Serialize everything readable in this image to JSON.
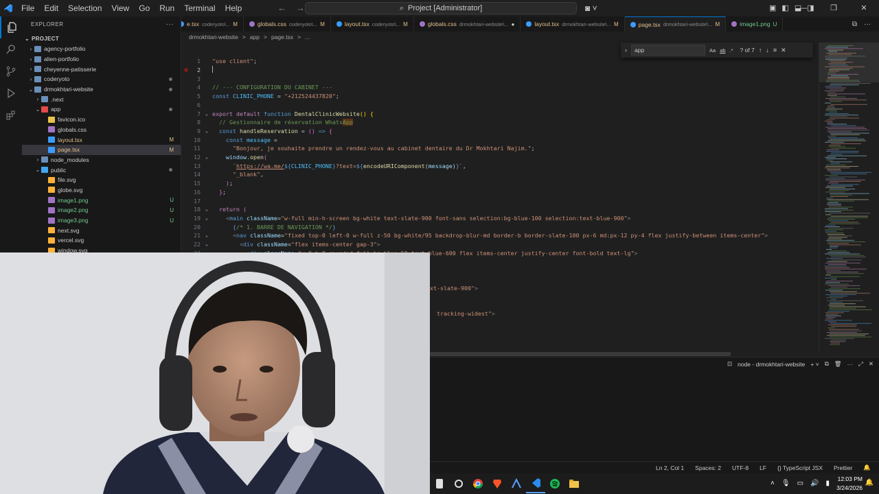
{
  "titlebar": {
    "menu": [
      "File",
      "Edit",
      "Selection",
      "View",
      "Go",
      "Run",
      "Terminal",
      "Help"
    ],
    "search_text": "Project [Administrator]"
  },
  "sidebar": {
    "title": "EXPLORER",
    "project_label": "PROJECT",
    "items": [
      {
        "label": "agency-portfolio",
        "type": "folder",
        "depth": 1,
        "open": false
      },
      {
        "label": "alien-portfolio",
        "type": "folder",
        "depth": 1,
        "open": false
      },
      {
        "label": "cheyenne-patisserie",
        "type": "folder",
        "depth": 1,
        "open": false
      },
      {
        "label": "coderyoto",
        "type": "folder",
        "depth": 1,
        "open": false,
        "dot": true
      },
      {
        "label": "drmokhtari-website",
        "type": "folder",
        "depth": 1,
        "open": true,
        "dot": true
      },
      {
        "label": ".next",
        "type": "folder",
        "depth": 2,
        "open": false
      },
      {
        "label": "app",
        "type": "folder-app",
        "depth": 2,
        "open": true,
        "dot": true
      },
      {
        "label": "favicon.ico",
        "type": "star",
        "depth": 3
      },
      {
        "label": "globals.css",
        "type": "css",
        "depth": 3
      },
      {
        "label": "layout.tsx",
        "type": "tsx",
        "depth": 3,
        "badge": "M"
      },
      {
        "label": "page.tsx",
        "type": "tsx",
        "depth": 3,
        "badge": "M",
        "selected": true
      },
      {
        "label": "node_modules",
        "type": "folder",
        "depth": 2,
        "open": false
      },
      {
        "label": "public",
        "type": "folder-public",
        "depth": 2,
        "open": true,
        "dot": true
      },
      {
        "label": "file.svg",
        "type": "svg",
        "depth": 3
      },
      {
        "label": "globe.svg",
        "type": "svg",
        "depth": 3
      },
      {
        "label": "image1.png",
        "type": "png",
        "depth": 3,
        "badge": "U"
      },
      {
        "label": "image2.png",
        "type": "png",
        "depth": 3,
        "badge": "U"
      },
      {
        "label": "image3.png",
        "type": "png",
        "depth": 3,
        "badge": "U"
      },
      {
        "label": "next.svg",
        "type": "svg",
        "depth": 3
      },
      {
        "label": "vercel.svg",
        "type": "svg",
        "depth": 3
      },
      {
        "label": "window.svg",
        "type": "svg",
        "depth": 3
      }
    ]
  },
  "tabs": [
    {
      "name": "e.tsx",
      "path": "coderyoto\\...",
      "mod": "M",
      "icon": "tsx"
    },
    {
      "name": "globals.css",
      "path": "coderyoto\\...",
      "mod": "M",
      "icon": "css"
    },
    {
      "name": "layout.tsx",
      "path": "coderyoto\\...",
      "mod": "M",
      "icon": "tsx"
    },
    {
      "name": "globals.css",
      "path": "drmokhtari-website\\...",
      "mod": "●",
      "icon": "css"
    },
    {
      "name": "layout.tsx",
      "path": "drmokhtari-website\\...",
      "mod": "M",
      "icon": "tsx"
    },
    {
      "name": "page.tsx",
      "path": "drmokhtari-website\\...",
      "mod": "M",
      "icon": "tsx",
      "active": true
    },
    {
      "name": "image1.png",
      "path": "",
      "mod": "U",
      "icon": "png"
    }
  ],
  "breadcrumb": [
    "drmokhtari-website",
    ">",
    "app",
    ">",
    "page.tsx",
    ">",
    "..."
  ],
  "find": {
    "value": "app",
    "count": "? of 7"
  },
  "editor": {
    "current_line": 2,
    "lines": [
      {
        "n": 1,
        "fold": "",
        "html": "<span class='t-str'>\"use client\"</span>;"
      },
      {
        "n": 2,
        "fold": "",
        "html": ""
      },
      {
        "n": 3,
        "fold": "",
        "html": ""
      },
      {
        "n": 4,
        "fold": "",
        "html": "<span class='t-cmt'>// --- CONFIGURATION DU CABINET ---</span>"
      },
      {
        "n": 5,
        "fold": "",
        "html": "<span class='t-kw'>const</span> <span class='t-const'>CLINIC_PHONE</span> = <span class='t-str'>\"+212524437820\"</span>;"
      },
      {
        "n": 6,
        "fold": "",
        "html": ""
      },
      {
        "n": 7,
        "fold": "v",
        "html": "<span class='t-ctl'>export</span> <span class='t-ctl'>default</span> <span class='t-kw'>function</span> <span class='t-fn'>DentalClinicWebsite</span><span class='t-yel'>()</span> <span class='t-yel'>{</span>"
      },
      {
        "n": 8,
        "fold": "",
        "html": "  <span class='t-cmt'>// Gestionnaire de réservation Whats<span class='t-hl'>App</span></span>"
      },
      {
        "n": 9,
        "fold": "v",
        "html": "  <span class='t-kw'>const</span> <span class='t-fn'>handleReservation</span> = <span class='t-pink'>()</span> <span class='t-kw'>=&gt;</span> <span class='t-pink'>{</span>"
      },
      {
        "n": 10,
        "fold": "",
        "html": "    <span class='t-kw'>const</span> <span class='t-const'>message</span> ="
      },
      {
        "n": 11,
        "fold": "",
        "html": "      <span class='t-str'>\"Bonjour, je souhaite prendre un rendez-vous au cabinet dentaire du Dr Mokhtari Najim.\"</span>;"
      },
      {
        "n": 12,
        "fold": "v",
        "html": "    <span class='t-var'>window</span>.<span class='t-fn'>open</span><span class='t-pink'>(</span>"
      },
      {
        "n": 13,
        "fold": "",
        "html": "      <span class='t-str'>`<u>https://wa.me/</u></span><span class='t-kw'>${</span><span class='t-const'>CLINIC_PHONE</span><span class='t-kw'>}</span><span class='t-str'>?text=</span><span class='t-kw'>${</span><span class='t-fn'>encodeURIComponent</span>(<span class='t-var'>message</span>)<span class='t-kw'>}</span><span class='t-str'>`</span>,"
      },
      {
        "n": 14,
        "fold": "",
        "html": "      <span class='t-str'>\"_blank\"</span>,"
      },
      {
        "n": 15,
        "fold": "",
        "html": "    <span class='t-pink'>)</span>;"
      },
      {
        "n": 16,
        "fold": "",
        "html": "  <span class='t-pink'>}</span>;"
      },
      {
        "n": 17,
        "fold": "",
        "html": ""
      },
      {
        "n": 18,
        "fold": "v",
        "html": "  <span class='t-ctl'>return</span> <span class='t-pink'>(</span>"
      },
      {
        "n": 19,
        "fold": "v",
        "html": "    <span class='t-punct'>&lt;</span><span class='t-tag'>main</span> <span class='t-attr'>className</span>=<span class='t-str'>\"w-full min-h-screen bg-white text-slate-900 font-sans selection:bg-blue-100 selection:text-blue-900\"</span><span class='t-punct'>&gt;</span>"
      },
      {
        "n": 20,
        "fold": "",
        "html": "      <span class='t-kw'>{</span><span class='t-cmt'>/* 1. BARRE DE NAVIGATION */</span><span class='t-kw'>}</span>"
      },
      {
        "n": 21,
        "fold": "v",
        "html": "      <span class='t-punct'>&lt;</span><span class='t-tag'>nav</span> <span class='t-attr'>className</span>=<span class='t-str'>\"fixed top-0 left-0 w-full z-50 bg-white/95 backdrop-blur-md border-b border-slate-100 px-6 md:px-12 py-4 flex justify-between items-center\"</span><span class='t-punct'>&gt;</span>"
      },
      {
        "n": 22,
        "fold": "v",
        "html": "        <span class='t-punct'>&lt;</span><span class='t-tag'>div</span> <span class='t-attr'>className</span>=<span class='t-str'>\"flex items-center gap-3\"</span><span class='t-punct'>&gt;</span>"
      },
      {
        "n": 23,
        "fold": "",
        "html": "          <span class='t-punct'>&lt;</span><span class='t-tag'>div</span> <span class='t-attr'>className</span>=<span class='t-str'>\"w-8 h-8 rounded-full bg-blue-50 text-blue-600 flex items-center justify-center font-bold text-lg\"</span><span class='t-punct'>&gt;</span>"
      }
    ],
    "partial_lines": [
      {
        "html": "<span class='t-str'>xt-slate-900\"</span><span class='t-punct'>&gt;</span>"
      },
      {
        "html": "<span class='t-str'>  tracking-widest\"</span><span class='t-punct'>&gt;</span>"
      }
    ]
  },
  "panel": {
    "terminal_label": "node - drmokhtari-website"
  },
  "statusbar": [
    "Ln 2, Col 1",
    "Spaces: 2",
    "UTF-8",
    "LF",
    "{} TypeScript JSX",
    "Prettier"
  ],
  "taskbar": {
    "time": "12:03 PM",
    "date": "3/24/2026"
  },
  "colors": {
    "accent": "#0078d4",
    "modified": "#e2c08d",
    "untracked": "#73c991"
  }
}
